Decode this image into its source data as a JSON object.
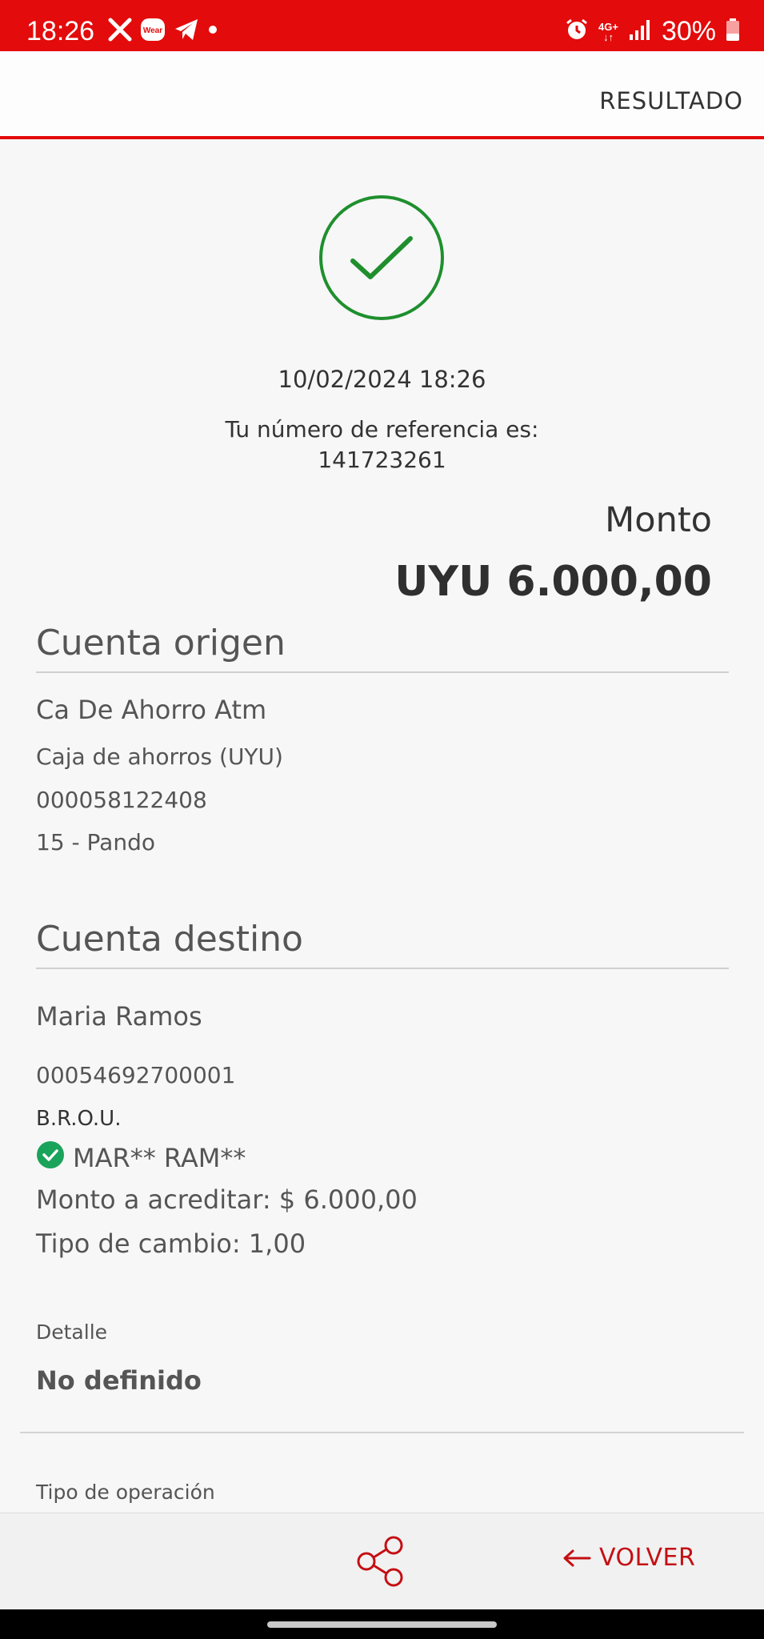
{
  "status_bar": {
    "time": "18:26",
    "network": "4G+",
    "battery": "30%",
    "notification_icons": [
      "x-icon",
      "wear-icon",
      "telegram-icon",
      "dot-icon"
    ],
    "system_icons": [
      "alarm-icon",
      "network-4g-icon",
      "signal-icon",
      "battery-icon"
    ],
    "wear_text": "Wear"
  },
  "header": {
    "title": "RESULTADO"
  },
  "result": {
    "datetime": "10/02/2024 18:26",
    "reference_label": "Tu número de referencia es:",
    "reference_number": "141723261",
    "amount_label": "Monto",
    "amount_value": "UYU 6.000,00"
  },
  "origin": {
    "title": "Cuenta origen",
    "account_name": "Ca De Ahorro Atm",
    "account_type": "Caja de ahorros (UYU)",
    "account_number": "000058122408",
    "branch": "15 - Pando"
  },
  "destination": {
    "title": "Cuenta destino",
    "holder": "Maria Ramos",
    "account_number": "00054692700001",
    "bank": "B.R.O.U.",
    "verified_name": "MAR** RAM**",
    "credit_amount": "Monto a acreditar: $ 6.000,00",
    "exchange_rate": "Tipo de cambio: 1,00"
  },
  "detail": {
    "label": "Detalle",
    "value": "No definido"
  },
  "operation": {
    "label": "Tipo de operación"
  },
  "bottom": {
    "back_label": "VOLVER"
  },
  "colors": {
    "brand_red": "#e30b0b",
    "success_green": "#1f8f2e",
    "verified_green": "#1aa35a"
  }
}
